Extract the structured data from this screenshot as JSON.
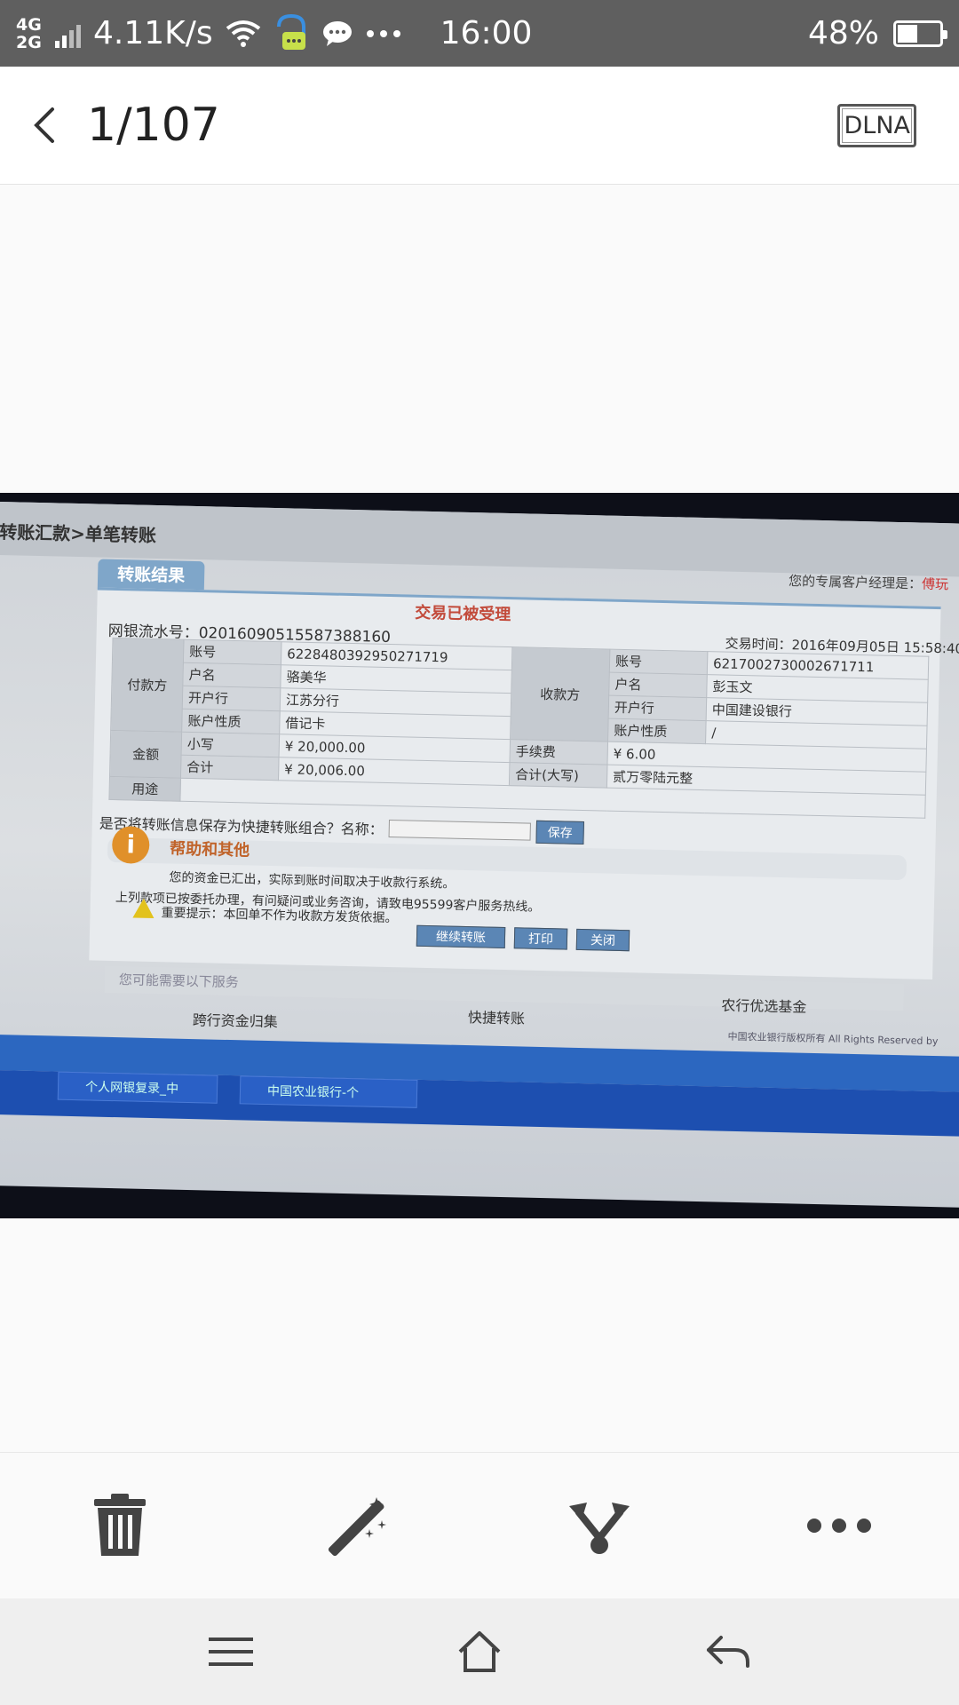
{
  "status_bar": {
    "net_type_top": "4G",
    "net_type_bottom": "2G",
    "net_speed": "4.11K/s",
    "time": "16:00",
    "battery_pct": "48%",
    "battery_level": 0.48,
    "icons": [
      "signal-icon",
      "wifi-icon",
      "chat-bubble-icon",
      "message-icon",
      "more-dots-icon"
    ]
  },
  "header": {
    "page_counter": "1/107",
    "dlna_label": "DLNA"
  },
  "photo": {
    "crumb": "转账汇款>单笔转账",
    "manager_note": "您的专属客户经理是：",
    "manager_name": "傅玩",
    "tab_label": "转账结果",
    "accepted_text": "交易已被受理",
    "serial_label": "网银流水号：",
    "serial_value": "02016090515587388160",
    "time_label": "交易时间：",
    "time_value": "2016年09月05日 15:58:40",
    "payer": {
      "group": "付款方",
      "account_label": "账号",
      "account": "6228480392950271719",
      "name_label": "户名",
      "name": "骆美华",
      "bank_label": "开户行",
      "bank": "江苏分行",
      "type_label": "账户性质",
      "type": "借记卡"
    },
    "payee": {
      "group": "收款方",
      "account_label": "账号",
      "account": "6217002730002671711",
      "name_label": "户名",
      "name": "彭玉文",
      "bank_label": "开户行",
      "bank": "中国建设银行",
      "type_label": "账户性质",
      "type": "/"
    },
    "amount": {
      "group": "金额",
      "lower_label": "小写",
      "lower": "¥ 20,000.00",
      "total_label": "合计",
      "total": "¥ 20,006.00",
      "fee_label": "手续费",
      "fee": "¥ 6.00",
      "total_upper_label": "合计(大写)",
      "total_upper": "贰万零陆元整"
    },
    "purpose_label": "用途",
    "save_prompt": "是否将转账信息保存为快捷转账组合？名称：",
    "save_btn": "保存",
    "help_title": "帮助和其他",
    "help_line1": "您的资金已汇出，实际到账时间取决于收款行系统。",
    "help_line2": "上列款项已按委托办理，有问疑问或业务咨询，请致电95599客户服务热线。",
    "help_line3": "重要提示：本回单不作为收款方发货依据。",
    "btn_continue": "继续转账",
    "btn_print": "打印",
    "btn_close": "关闭",
    "services_label": "您可能需要以下服务",
    "svc1": "跨行资金归集",
    "svc2": "快捷转账",
    "svc3": "农行优选基金",
    "copyright": "中国农业银行版权所有 All Rights Reserved by",
    "task1": "个人网银复录_中",
    "task2": "中国农业银行-个"
  },
  "toolbar": {
    "icons": [
      "trash-icon",
      "magic-wand-icon",
      "share-icon",
      "more-icon"
    ]
  },
  "navbar": {
    "icons": [
      "menu-icon",
      "home-icon",
      "back-arrow-icon"
    ]
  }
}
